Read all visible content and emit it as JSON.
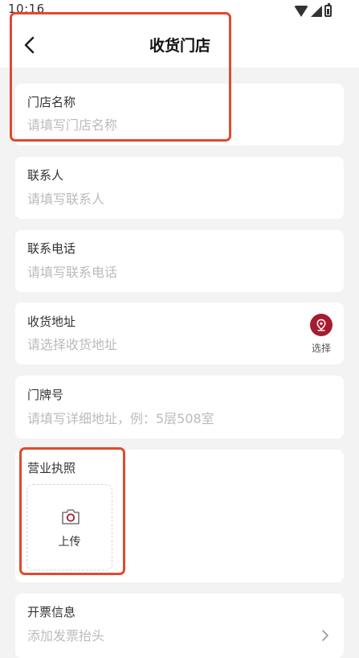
{
  "status": {
    "time": "10:16"
  },
  "header": {
    "title": "收货门店"
  },
  "fields": {
    "store_name": {
      "label": "门店名称",
      "placeholder": "请填写门店名称"
    },
    "contact": {
      "label": "联系人",
      "placeholder": "请填写联系人"
    },
    "phone": {
      "label": "联系电话",
      "placeholder": "请填写联系电话"
    },
    "address": {
      "label": "收货地址",
      "placeholder": "请选择收货地址",
      "select_label": "选择"
    },
    "house_number": {
      "label": "门牌号",
      "placeholder": "请填写详细地址，例：5层508室"
    },
    "license": {
      "label": "营业执照",
      "upload_label": "上传"
    },
    "invoice": {
      "label": "开票信息",
      "placeholder": "添加发票抬头"
    }
  },
  "colors": {
    "accent": "#a51c30",
    "highlight": "#e04a2f"
  },
  "icons": [
    "back-icon",
    "wifi-icon",
    "signal-icon",
    "battery-icon",
    "location-pin-icon",
    "camera-icon",
    "chevron-right-icon"
  ]
}
